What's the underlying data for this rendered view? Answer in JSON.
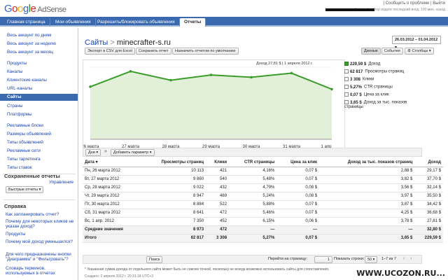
{
  "header": {
    "logo": "Google AdSense",
    "links": "| Сообщить о проблеме | Выйти",
    "info": "Идентификатор издате                последний вход: 100 мин. назад"
  },
  "tabs": [
    "Главная страница",
    "Мои объявления",
    "Разрешить/блокировать объявления",
    "Отчеты"
  ],
  "sidebar": {
    "items": [
      "Весь аккаунт по дням",
      "Весь аккаунт за неделю",
      "Весь аккаунт за месяц",
      "Продукты",
      "Каналы",
      "Клиентские каналы",
      "URL-каналы",
      "Сайты",
      "Страны",
      "Платформы",
      "Рекламные блоки",
      "Размеры объявлений",
      "Типы объявлений",
      "Рекламные сети",
      "Типы таргетинга",
      "Типы ставок"
    ],
    "saved_title": "Сохраненные отчеты",
    "manage": "Управление",
    "quick": "Быстрые отчеты",
    "help_title": "Справка",
    "help_items": [
      "Как запланировать отчет?",
      "Почему для некоторых кликов не указан доход?",
      "Продукты",
      "Почему мой доход уменьшился?",
      "Для чего предназначены кнопки \"Диаграмма\" и \"Фильтровать\"?",
      "Словарь терминов, используемых в отчетах"
    ]
  },
  "main": {
    "crumb": "Сайты",
    "sep": ">",
    "site": "minecrafter-s.ru",
    "date_range": "26.03.2012 – 01.04.2012",
    "btn_csv": "Экспорт в CSV для Excel",
    "btn_save": "Сохранить отчет",
    "btn_default": "Назначить отчетом по умолчанию",
    "btn_data": "Данные",
    "btn_events": "События",
    "btn_columns": "Столбцы",
    "btn_days": "Дни",
    "btn_add": "Добавить параметр",
    "chart_tip": "Доход 27,81 $  | 1 апреля 2012 г."
  },
  "chart_data": {
    "type": "line",
    "x": [
      "26 марта",
      "27 марта",
      "28 марта",
      "29 марта",
      "30 марта",
      "31 марта",
      "1 апр"
    ],
    "values": [
      29.17,
      37.7,
      32.78,
      35.7,
      34.42,
      36.68,
      27.81
    ],
    "series_color": "#3a9d2a",
    "ylim": [
      0,
      40
    ]
  },
  "legend": [
    {
      "value": "229,59 $",
      "label": "Доход",
      "on": true
    },
    {
      "value": "62 817",
      "label": "Просмотры страниц",
      "on": false
    },
    {
      "value": "3 308",
      "label": "Клики",
      "on": false
    },
    {
      "value": "5,27%",
      "label": "CTR страницы",
      "on": false
    },
    {
      "value": "0,07 $",
      "label": "Цена за клик",
      "on": false
    },
    {
      "value": "3,65 $",
      "label": "Доход за тыс. показов страницы",
      "on": false
    }
  ],
  "table": {
    "headers": [
      "Дата",
      "Просмотры страниц",
      "Клики",
      "CTR страницы",
      "Цена за клик",
      "Доход за тыс. показов страниц",
      "Доход"
    ],
    "rows": [
      [
        "Пн, 26 марта 2012",
        "10 113",
        "421",
        "4,16%",
        "0,07 $",
        "2,88 $",
        "29,17 $"
      ],
      [
        "Вт, 27 марта 2012",
        "9 860",
        "540",
        "5,48%",
        "0,07 $",
        "3,82 $",
        "37,70 $"
      ],
      [
        "Ср, 28 марта 2012",
        "9 022",
        "432",
        "4,79%",
        "0,08 $",
        "3,56 $",
        "32,14 $"
      ],
      [
        "Чт, 29 марта 2012",
        "8 947",
        "469",
        "5,24%",
        "0,08 $",
        "3,97 $",
        "35,50 $"
      ],
      [
        "Пт, 30 марта 2012",
        "8 884",
        "522",
        "5,88%",
        "0,07 $",
        "3,87 $",
        "34,42 $"
      ],
      [
        "Сб, 31 марта 2012",
        "8 641",
        "472",
        "5,46%",
        "0,07 $",
        "4,25 $",
        "36,68 $"
      ],
      [
        "Вс, 1 апр. 2012",
        "7 350",
        "452",
        "6,15%",
        "0,06 $",
        "3,78 $",
        "27,81 $"
      ]
    ],
    "avg": [
      "Средние значения",
      "8 973",
      "472",
      "—",
      "—",
      "—",
      "32,80 $"
    ],
    "total": [
      "Итого",
      "62 817",
      "3 308",
      "5,27%",
      "0,07 $",
      "3,65 $",
      "229,59 $"
    ]
  },
  "search_btn": "Поиск",
  "pager": {
    "goto": "Перейти на страницу:",
    "page": "1",
    "rows_label": "Показать строки:",
    "rows": "50",
    "range": "1–7 из 7"
  },
  "note": "* Указанная сумма дохода от отдельного сайта может быть не совсем точной, поскольку не всегда возможно использовать сайты для сопоставления.",
  "note2": "Создано: 2 апреля 2012 г. 20:31:18 UTC+3",
  "watermark": "WWW.UCOZON.RU..."
}
